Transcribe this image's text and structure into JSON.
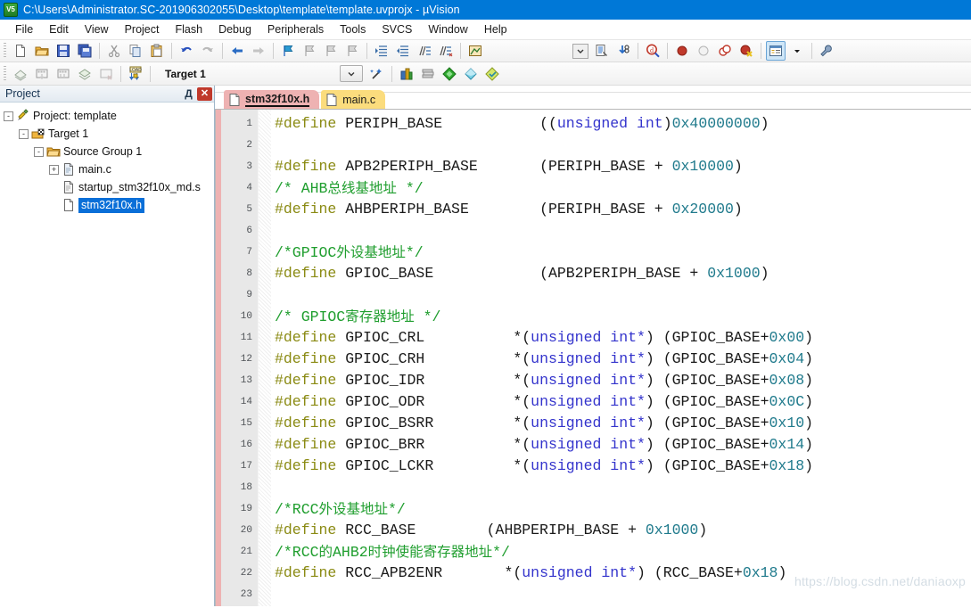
{
  "window": {
    "title": "C:\\Users\\Administrator.SC-201906302055\\Desktop\\template\\template.uvprojx - µVision",
    "app_icon": "uvision-icon",
    "icon_text": "V5"
  },
  "menubar": {
    "items": [
      {
        "label": "File"
      },
      {
        "label": "Edit"
      },
      {
        "label": "View"
      },
      {
        "label": "Project"
      },
      {
        "label": "Flash"
      },
      {
        "label": "Debug"
      },
      {
        "label": "Peripherals"
      },
      {
        "label": "Tools"
      },
      {
        "label": "SVCS"
      },
      {
        "label": "Window"
      },
      {
        "label": "Help"
      }
    ]
  },
  "toolbar_main": {
    "buttons": [
      "new-file-icon",
      "open-file-icon",
      "save-icon",
      "save-all-icon",
      "cut-icon",
      "copy-icon",
      "paste-icon",
      "undo-icon",
      "redo-icon",
      "navigate-back-icon",
      "navigate-forward-icon",
      "bookmark-toggle-icon",
      "bookmark-prev-icon",
      "bookmark-next-icon",
      "bookmark-clear-icon",
      "indent-increase-icon",
      "indent-decrease-icon",
      "comment-lines-icon",
      "uncomment-lines-icon",
      "build-output-icon"
    ],
    "right_buttons": [
      "combo-dropdown-icon",
      "project-window-icon",
      "configure-icon",
      "find-in-files-icon",
      "insert-breakpoint-icon",
      "disable-breakpoint-icon",
      "disable-all-breakpoints-icon",
      "kill-all-breakpoints-icon",
      "manage-components-icon",
      "components-dropdown-icon",
      "options-target-icon"
    ]
  },
  "toolbar_build": {
    "buttons": [
      "translate-icon",
      "build-icon",
      "rebuild-icon",
      "batch-build-icon",
      "stop-build-icon",
      "download-icon"
    ],
    "target": {
      "value": "Target 1",
      "dropdown_icon": "chevron-down-icon",
      "wizard_icon": "target-wizard-icon"
    },
    "right_buttons": [
      "manage-project-items-icon",
      "books-icon",
      "options-icon",
      "packs-icon",
      "pack-installer-icon"
    ]
  },
  "project_panel": {
    "title": "Project",
    "pin_icon": "pin-icon",
    "pin_glyph": "Д",
    "close_icon": "close-icon",
    "close_glyph": "✕",
    "tree": [
      {
        "label": "Project: template",
        "icon": "project-icon",
        "expander": "-",
        "depth": 0,
        "selected": false
      },
      {
        "label": "Target 1",
        "icon": "target-icon",
        "expander": "-",
        "depth": 1,
        "selected": false
      },
      {
        "label": "Source Group 1",
        "icon": "folder-icon",
        "expander": "-",
        "depth": 2,
        "selected": false
      },
      {
        "label": "main.c",
        "icon": "c-file-icon",
        "expander": "+",
        "depth": 3,
        "selected": false
      },
      {
        "label": "startup_stm32f10x_md.s",
        "icon": "asm-file-icon",
        "expander": "",
        "depth": 3,
        "selected": false
      },
      {
        "label": "stm32f10x.h",
        "icon": "header-file-icon",
        "expander": "",
        "depth": 3,
        "selected": true
      }
    ]
  },
  "editor": {
    "tabs": [
      {
        "label": "stm32f10x.h",
        "active": true,
        "color": "#eeb2b2",
        "icon": "header-file-icon"
      },
      {
        "label": "main.c",
        "active": false,
        "color": "#fbdc7d",
        "icon": "c-file-icon"
      }
    ],
    "watermark": "https://blog.csdn.net/daniaoxp",
    "line_numbers": [
      1,
      2,
      3,
      4,
      5,
      6,
      7,
      8,
      9,
      10,
      11,
      12,
      13,
      14,
      15,
      16,
      17,
      18,
      19,
      20,
      21,
      22,
      23
    ],
    "lines": [
      {
        "n": 1,
        "tokens": [
          {
            "t": "#define ",
            "c": "def"
          },
          {
            "t": "PERIPH_BASE",
            "c": "id"
          },
          {
            "t": "           ",
            "c": "pun"
          },
          {
            "t": "((",
            "c": "pun"
          },
          {
            "t": "unsigned int",
            "c": "kw"
          },
          {
            "t": ")",
            "c": "pun"
          },
          {
            "t": "0x40000000",
            "c": "num"
          },
          {
            "t": ")",
            "c": "pun"
          }
        ]
      },
      {
        "n": 2,
        "tokens": []
      },
      {
        "n": 3,
        "tokens": [
          {
            "t": "#define ",
            "c": "def"
          },
          {
            "t": "APB2PERIPH_BASE",
            "c": "id"
          },
          {
            "t": "       ",
            "c": "pun"
          },
          {
            "t": "(PERIPH_BASE + ",
            "c": "pun"
          },
          {
            "t": "0x10000",
            "c": "num"
          },
          {
            "t": ")",
            "c": "pun"
          }
        ]
      },
      {
        "n": 4,
        "tokens": [
          {
            "t": "/* AHB",
            "c": "cmt"
          },
          {
            "t": "总线基地址",
            "c": "cmt-cn"
          },
          {
            "t": " */",
            "c": "cmt"
          }
        ]
      },
      {
        "n": 5,
        "tokens": [
          {
            "t": "#define ",
            "c": "def"
          },
          {
            "t": "AHBPERIPH_BASE",
            "c": "id"
          },
          {
            "t": "        ",
            "c": "pun"
          },
          {
            "t": "(PERIPH_BASE + ",
            "c": "pun"
          },
          {
            "t": "0x20000",
            "c": "num"
          },
          {
            "t": ")",
            "c": "pun"
          }
        ]
      },
      {
        "n": 6,
        "tokens": []
      },
      {
        "n": 7,
        "tokens": [
          {
            "t": "/*GPIOC",
            "c": "cmt"
          },
          {
            "t": "外设基地址",
            "c": "cmt-cn"
          },
          {
            "t": "*/",
            "c": "cmt"
          }
        ]
      },
      {
        "n": 8,
        "tokens": [
          {
            "t": "#define ",
            "c": "def"
          },
          {
            "t": "GPIOC_BASE",
            "c": "id"
          },
          {
            "t": "            ",
            "c": "pun"
          },
          {
            "t": "(APB2PERIPH_BASE + ",
            "c": "pun"
          },
          {
            "t": "0x1000",
            "c": "num"
          },
          {
            "t": ")",
            "c": "pun"
          }
        ]
      },
      {
        "n": 9,
        "tokens": []
      },
      {
        "n": 10,
        "tokens": [
          {
            "t": "/* GPIOC",
            "c": "cmt"
          },
          {
            "t": "寄存器地址",
            "c": "cmt-cn"
          },
          {
            "t": " */",
            "c": "cmt"
          }
        ]
      },
      {
        "n": 11,
        "tokens": [
          {
            "t": "#define ",
            "c": "def"
          },
          {
            "t": "GPIOC_CRL",
            "c": "id"
          },
          {
            "t": "          *(",
            "c": "pun"
          },
          {
            "t": "unsigned int",
            "c": "kw"
          },
          {
            "t": "*",
            "c": "kw"
          },
          {
            "t": ") (GPIOC_BASE+",
            "c": "pun"
          },
          {
            "t": "0x00",
            "c": "num"
          },
          {
            "t": ")",
            "c": "pun"
          }
        ]
      },
      {
        "n": 12,
        "tokens": [
          {
            "t": "#define ",
            "c": "def"
          },
          {
            "t": "GPIOC_CRH",
            "c": "id"
          },
          {
            "t": "          *(",
            "c": "pun"
          },
          {
            "t": "unsigned int",
            "c": "kw"
          },
          {
            "t": "*",
            "c": "kw"
          },
          {
            "t": ") (GPIOC_BASE+",
            "c": "pun"
          },
          {
            "t": "0x04",
            "c": "num"
          },
          {
            "t": ")",
            "c": "pun"
          }
        ]
      },
      {
        "n": 13,
        "tokens": [
          {
            "t": "#define ",
            "c": "def"
          },
          {
            "t": "GPIOC_IDR",
            "c": "id"
          },
          {
            "t": "          *(",
            "c": "pun"
          },
          {
            "t": "unsigned int",
            "c": "kw"
          },
          {
            "t": "*",
            "c": "kw"
          },
          {
            "t": ") (GPIOC_BASE+",
            "c": "pun"
          },
          {
            "t": "0x08",
            "c": "num"
          },
          {
            "t": ")",
            "c": "pun"
          }
        ]
      },
      {
        "n": 14,
        "tokens": [
          {
            "t": "#define ",
            "c": "def"
          },
          {
            "t": "GPIOC_ODR",
            "c": "id"
          },
          {
            "t": "          *(",
            "c": "pun"
          },
          {
            "t": "unsigned int",
            "c": "kw"
          },
          {
            "t": "*",
            "c": "kw"
          },
          {
            "t": ") (GPIOC_BASE+",
            "c": "pun"
          },
          {
            "t": "0x0C",
            "c": "num"
          },
          {
            "t": ")",
            "c": "pun"
          }
        ]
      },
      {
        "n": 15,
        "tokens": [
          {
            "t": "#define ",
            "c": "def"
          },
          {
            "t": "GPIOC_BSRR",
            "c": "id"
          },
          {
            "t": "         *(",
            "c": "pun"
          },
          {
            "t": "unsigned int",
            "c": "kw"
          },
          {
            "t": "*",
            "c": "kw"
          },
          {
            "t": ") (GPIOC_BASE+",
            "c": "pun"
          },
          {
            "t": "0x10",
            "c": "num"
          },
          {
            "t": ")",
            "c": "pun"
          }
        ]
      },
      {
        "n": 16,
        "tokens": [
          {
            "t": "#define ",
            "c": "def"
          },
          {
            "t": "GPIOC_BRR",
            "c": "id"
          },
          {
            "t": "          *(",
            "c": "pun"
          },
          {
            "t": "unsigned int",
            "c": "kw"
          },
          {
            "t": "*",
            "c": "kw"
          },
          {
            "t": ") (GPIOC_BASE+",
            "c": "pun"
          },
          {
            "t": "0x14",
            "c": "num"
          },
          {
            "t": ")",
            "c": "pun"
          }
        ]
      },
      {
        "n": 17,
        "tokens": [
          {
            "t": "#define ",
            "c": "def"
          },
          {
            "t": "GPIOC_LCKR",
            "c": "id"
          },
          {
            "t": "         *(",
            "c": "pun"
          },
          {
            "t": "unsigned int",
            "c": "kw"
          },
          {
            "t": "*",
            "c": "kw"
          },
          {
            "t": ") (GPIOC_BASE+",
            "c": "pun"
          },
          {
            "t": "0x18",
            "c": "num"
          },
          {
            "t": ")",
            "c": "pun"
          }
        ]
      },
      {
        "n": 18,
        "tokens": []
      },
      {
        "n": 19,
        "tokens": [
          {
            "t": "/*RCC",
            "c": "cmt"
          },
          {
            "t": "外设基地址",
            "c": "cmt-cn"
          },
          {
            "t": "*/",
            "c": "cmt"
          }
        ]
      },
      {
        "n": 20,
        "tokens": [
          {
            "t": "#define ",
            "c": "def"
          },
          {
            "t": "RCC_BASE",
            "c": "id"
          },
          {
            "t": "        (AHBPERIPH_BASE + ",
            "c": "pun"
          },
          {
            "t": "0x1000",
            "c": "num"
          },
          {
            "t": ")",
            "c": "pun"
          }
        ]
      },
      {
        "n": 21,
        "tokens": [
          {
            "t": "/*RCC",
            "c": "cmt"
          },
          {
            "t": "的",
            "c": "cmt-cn"
          },
          {
            "t": "AHB2",
            "c": "cmt"
          },
          {
            "t": "时钟使能寄存器地址",
            "c": "cmt-cn"
          },
          {
            "t": "*/",
            "c": "cmt"
          }
        ]
      },
      {
        "n": 22,
        "tokens": [
          {
            "t": "#define ",
            "c": "def"
          },
          {
            "t": "RCC_APB2ENR",
            "c": "id"
          },
          {
            "t": "       *(",
            "c": "pun"
          },
          {
            "t": "unsigned int",
            "c": "kw"
          },
          {
            "t": "*",
            "c": "kw"
          },
          {
            "t": ") (RCC_BASE+",
            "c": "pun"
          },
          {
            "t": "0x18",
            "c": "num"
          },
          {
            "t": ")",
            "c": "pun"
          }
        ]
      },
      {
        "n": 23,
        "tokens": []
      }
    ]
  },
  "colors": {
    "titlebar": "#0078d7",
    "selection": "#0a6fd8",
    "active_tab": "#eeb2b2",
    "inactive_tab": "#fbdc7d",
    "preprocessor": "#8a8a12",
    "keyword": "#3333cc",
    "number": "#1f7a8c",
    "comment": "#1f9e2e"
  }
}
